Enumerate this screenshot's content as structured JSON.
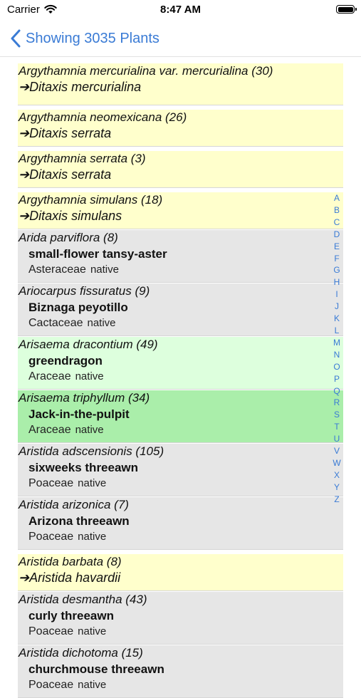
{
  "status": {
    "carrier": "Carrier",
    "time": "8:47 AM"
  },
  "nav": {
    "back_label": "Showing 3035 Plants"
  },
  "rows": [
    {
      "kind": "syn",
      "color": "yellow",
      "sci": "Argythamnia mercurialina var. mercurialina  (30)",
      "redirect": "➔Ditaxis mercurialina"
    },
    {
      "kind": "syn",
      "color": "yellow",
      "sci": "Argythamnia neomexicana  (26)",
      "redirect": "➔Ditaxis serrata"
    },
    {
      "kind": "syn",
      "color": "yellow",
      "sci": "Argythamnia serrata  (3)",
      "redirect": "➔Ditaxis serrata"
    },
    {
      "kind": "syn",
      "color": "yellow",
      "sci": "Argythamnia simulans  (18)",
      "redirect": "➔Ditaxis simulans"
    },
    {
      "kind": "full",
      "color": "gray",
      "sci": "Arida parviflora  (8)",
      "common": "small-flower tansy-aster",
      "family": "Asteraceae",
      "status": "native"
    },
    {
      "kind": "full",
      "color": "gray",
      "sci": "Ariocarpus fissuratus  (9)",
      "common": "Biznaga peyotillo",
      "family": "Cactaceae",
      "status": "native"
    },
    {
      "kind": "full",
      "color": "lightgreen",
      "sci": "Arisaema dracontium  (49)",
      "common": "greendragon",
      "family": "Araceae",
      "status": "native"
    },
    {
      "kind": "full",
      "color": "green",
      "sci": "Arisaema triphyllum  (34)",
      "common": "Jack-in-the-pulpit",
      "family": "Araceae",
      "status": "native"
    },
    {
      "kind": "full",
      "color": "gray",
      "sci": "Aristida adscensionis  (105)",
      "common": "sixweeks threeawn",
      "family": "Poaceae",
      "status": "native"
    },
    {
      "kind": "full",
      "color": "gray",
      "sci": "Aristida arizonica  (7)",
      "common": "Arizona threeawn",
      "family": "Poaceae",
      "status": "native"
    },
    {
      "kind": "syn",
      "color": "yellow",
      "sci": "Aristida barbata  (8)",
      "redirect": "➔Aristida havardii"
    },
    {
      "kind": "full",
      "color": "gray",
      "sci": "Aristida desmantha  (43)",
      "common": "curly threeawn",
      "family": "Poaceae",
      "status": "native"
    },
    {
      "kind": "full",
      "color": "gray",
      "sci": "Aristida dichotoma  (15)",
      "common": "churchmouse threeawn",
      "family": "Poaceae",
      "status": "native"
    }
  ],
  "index_letters": [
    "A",
    "B",
    "C",
    "D",
    "E",
    "F",
    "G",
    "H",
    "I",
    "J",
    "K",
    "L",
    "M",
    "N",
    "O",
    "P",
    "Q",
    "R",
    "S",
    "T",
    "U",
    "V",
    "W",
    "X",
    "Y",
    "Z"
  ]
}
